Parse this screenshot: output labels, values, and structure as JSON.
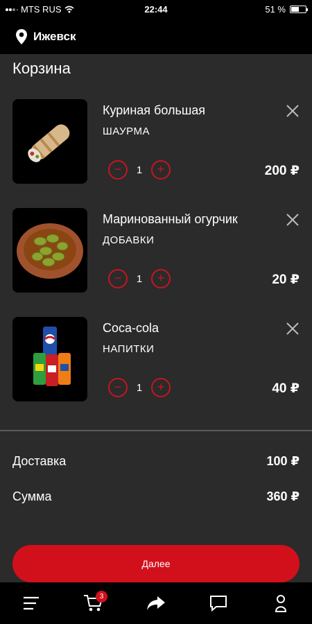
{
  "status_bar": {
    "carrier": "MTS RUS",
    "time": "22:44",
    "battery": "51 %",
    "battery_level": 0.51
  },
  "header": {
    "city": "Ижевск",
    "icon": "location-pin-icon"
  },
  "page": {
    "title": "Корзина"
  },
  "cart": {
    "items": [
      {
        "name": "Куриная большая",
        "category": "ШАУРМА",
        "quantity": "1",
        "price": "200 ₽",
        "image": "shawarma"
      },
      {
        "name": "Маринованный огурчик",
        "category": "ДОБАВКИ",
        "quantity": "1",
        "price": "20 ₽",
        "image": "pickles-bowl"
      },
      {
        "name": "Coca-cola",
        "category": "НАПИТКИ",
        "quantity": "1",
        "price": "40 ₽",
        "image": "soda-cans"
      }
    ]
  },
  "summary": {
    "delivery_label": "Доставка",
    "delivery_value": "100 ₽",
    "total_label": "Сумма",
    "total_value": "360 ₽"
  },
  "next_button": {
    "label": "Далее"
  },
  "tabbar": {
    "cart_badge": "3",
    "icons": [
      "menu-icon",
      "cart-icon",
      "share-icon",
      "chat-icon",
      "profile-icon"
    ]
  },
  "colors": {
    "accent": "#d1101c",
    "background": "#2b2b2b",
    "bar": "#000000"
  }
}
